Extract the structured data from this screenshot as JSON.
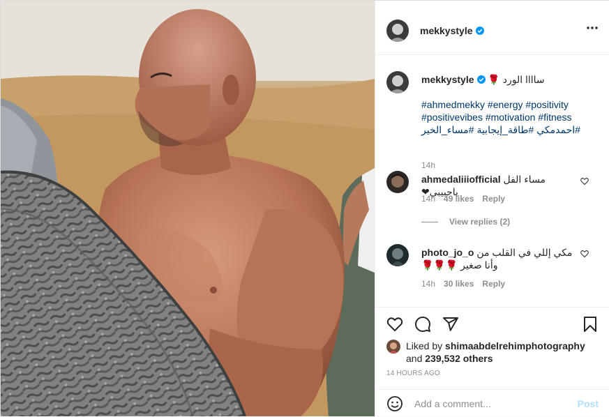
{
  "post": {
    "username": "mekkystyle",
    "verified": true,
    "more_icon": "more-horizontal-icon"
  },
  "caption": {
    "username": "mekkystyle",
    "text": "ساااا الورد 🌹",
    "hashtags": [
      "#ahmedmekky #energy #positivity",
      "#positivevibes #motivation #fitness",
      "#احمدمكي #طاقة_إيجابية #مساء_الخير"
    ],
    "time": "14h"
  },
  "comments": [
    {
      "username": "ahmedaliiiofficial",
      "text": "مساء الفل ياحبيبي❤",
      "time": "14h",
      "likes": "49 likes",
      "reply_label": "Reply",
      "view_replies": "View replies (2)"
    },
    {
      "username": "photo_jo_o",
      "text": "مكي إللي في القلب من وأنا صغير 🌹🌹🌹",
      "time": "14h",
      "likes": "30 likes",
      "reply_label": "Reply"
    }
  ],
  "actions": {
    "icons": [
      "heart-icon",
      "comment-icon",
      "share-icon",
      "bookmark-icon"
    ],
    "liked_by_prefix": "Liked by",
    "liked_by_user": "shimaabdelrehimphotography",
    "and_label": "and",
    "others": "239,532 others",
    "timestamp": "14 HOURS AGO"
  },
  "add_comment": {
    "placeholder": "Add a comment...",
    "post_label": "Post"
  },
  "colors": {
    "link": "#00376b",
    "verified": "#0095f6",
    "muted": "#8e8e8e",
    "post_disabled": "#b2dffc"
  }
}
